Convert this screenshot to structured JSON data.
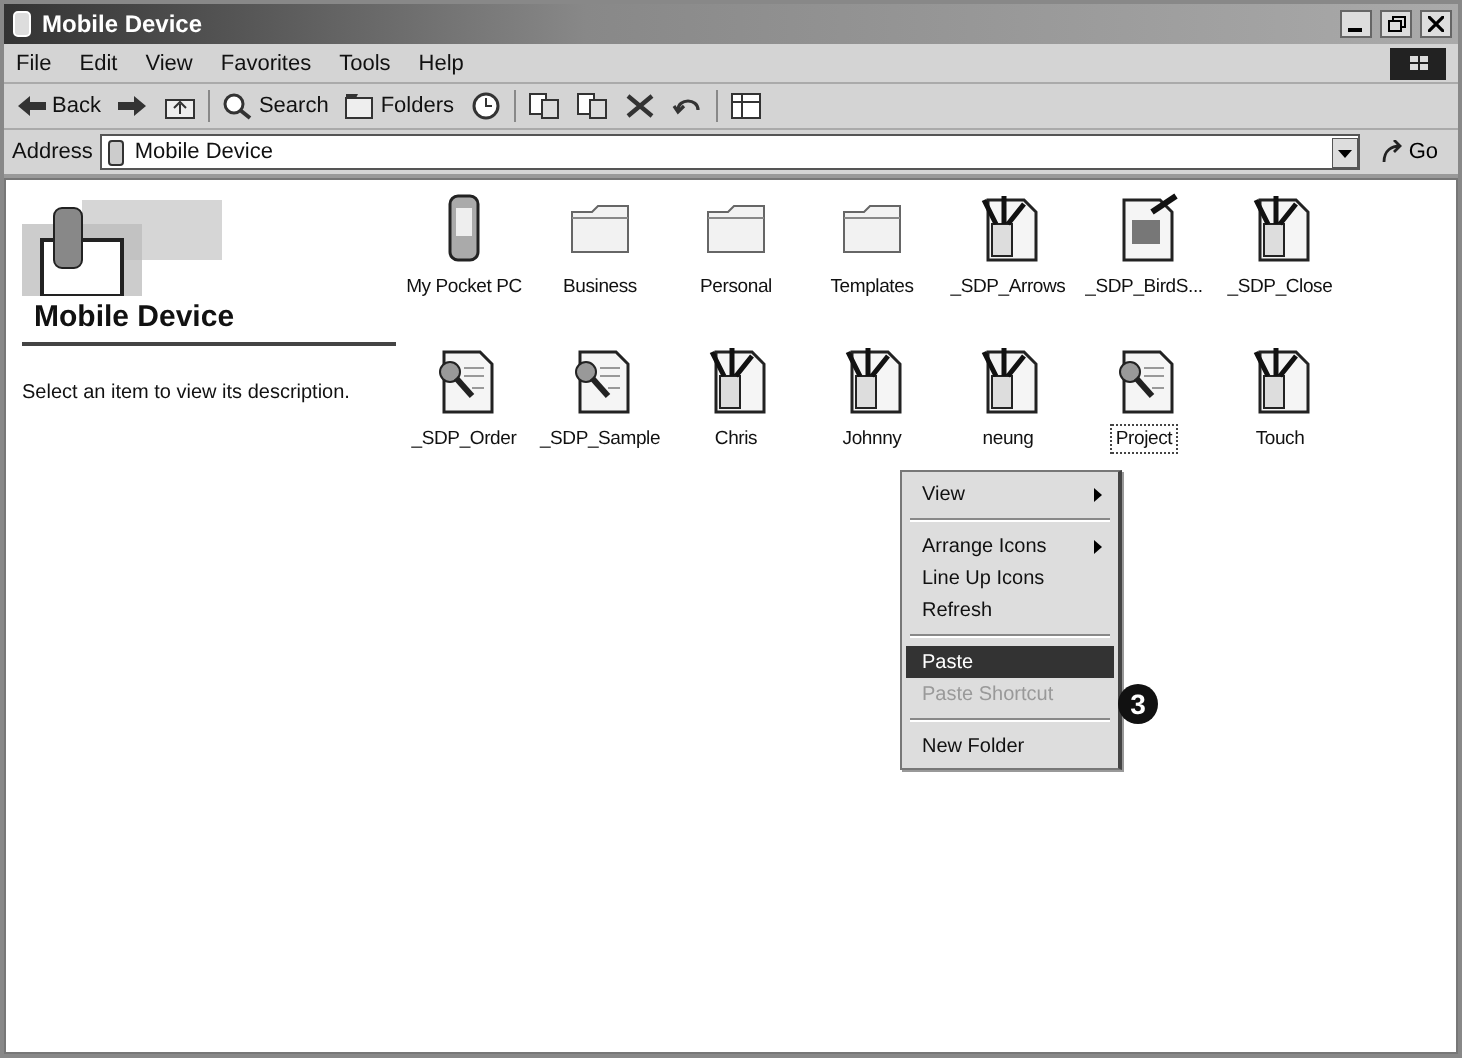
{
  "window": {
    "title": "Mobile Device"
  },
  "menu_bar": [
    "File",
    "Edit",
    "View",
    "Favorites",
    "Tools",
    "Help"
  ],
  "toolbar": [
    {
      "kind": "back",
      "label": "Back"
    },
    {
      "kind": "forward"
    },
    {
      "kind": "up"
    },
    {
      "kind": "search",
      "label": "Search"
    },
    {
      "kind": "folders",
      "label": "Folders"
    },
    {
      "kind": "history"
    },
    {
      "kind": "move"
    },
    {
      "kind": "copy"
    },
    {
      "kind": "delete"
    },
    {
      "kind": "undo"
    },
    {
      "kind": "views"
    }
  ],
  "address": {
    "label": "Address",
    "value": "Mobile Device",
    "go": "Go"
  },
  "info_pane": {
    "title": "Mobile Device",
    "description": "Select an item to view its description."
  },
  "items": [
    {
      "name": "My Pocket PC",
      "kind": "device",
      "selected": false
    },
    {
      "name": "Business",
      "kind": "folder",
      "selected": false
    },
    {
      "name": "Personal",
      "kind": "folder",
      "selected": false
    },
    {
      "name": "Templates",
      "kind": "folder",
      "selected": false
    },
    {
      "name": "_SDP_Arrows",
      "kind": "app",
      "selected": false
    },
    {
      "name": "_SDP_BirdS...",
      "kind": "image",
      "selected": false
    },
    {
      "name": "_SDP_Close",
      "kind": "app",
      "selected": false
    },
    {
      "name": "_SDP_Order",
      "kind": "doc",
      "selected": false
    },
    {
      "name": "_SDP_Sample",
      "kind": "doc",
      "selected": false
    },
    {
      "name": "Chris",
      "kind": "app",
      "selected": false
    },
    {
      "name": "Johnny",
      "kind": "app",
      "selected": false
    },
    {
      "name": "neung",
      "kind": "app",
      "selected": false
    },
    {
      "name": "Project",
      "kind": "doc",
      "selected": true
    },
    {
      "name": "Touch",
      "kind": "app",
      "selected": false
    }
  ],
  "context_menu": [
    {
      "kind": "item",
      "label": "View",
      "submenu": true,
      "selected": false,
      "disabled": false
    },
    {
      "kind": "separator"
    },
    {
      "kind": "item",
      "label": "Arrange Icons",
      "submenu": true,
      "selected": false,
      "disabled": false
    },
    {
      "kind": "item",
      "label": "Line Up Icons",
      "submenu": false,
      "selected": false,
      "disabled": false
    },
    {
      "kind": "item",
      "label": "Refresh",
      "submenu": false,
      "selected": false,
      "disabled": false
    },
    {
      "kind": "separator"
    },
    {
      "kind": "item",
      "label": "Paste",
      "submenu": false,
      "selected": true,
      "disabled": false
    },
    {
      "kind": "item",
      "label": "Paste Shortcut",
      "submenu": false,
      "selected": false,
      "disabled": true
    },
    {
      "kind": "separator"
    },
    {
      "kind": "item",
      "label": "New Folder",
      "submenu": false,
      "selected": false,
      "disabled": false
    }
  ],
  "callout": "3"
}
